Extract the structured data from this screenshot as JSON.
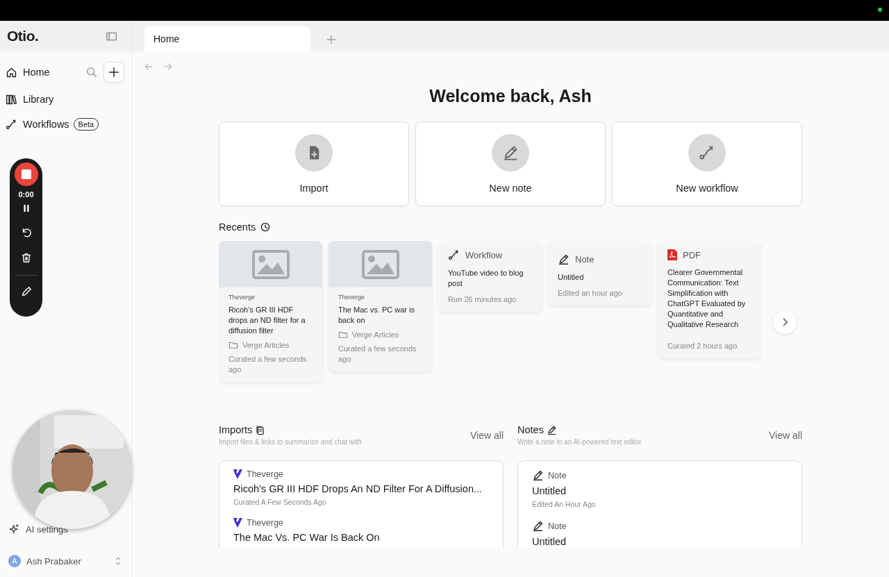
{
  "sidebar": {
    "logo": "Otio.",
    "nav": [
      {
        "kind": "home",
        "label": "Home"
      },
      {
        "kind": "library",
        "label": "Library"
      },
      {
        "kind": "workflows",
        "label": "Workflows",
        "badge": "Beta"
      }
    ],
    "bottom": [
      {
        "kind": "ai",
        "label": "AI settings"
      }
    ],
    "user": {
      "initial": "A",
      "name": "Ash Prabaker"
    }
  },
  "recorder": {
    "time": "0:00"
  },
  "tabs": [
    {
      "label": "Home",
      "selected": true
    }
  ],
  "heading": "Welcome back, Ash",
  "actions": [
    {
      "kind": "import",
      "label": "Import"
    },
    {
      "kind": "note",
      "label": "New note"
    },
    {
      "kind": "workflow",
      "label": "New workflow"
    }
  ],
  "recents": {
    "title": "Recents",
    "items": [
      {
        "kind": "article",
        "source": "Theverge",
        "title": "Ricoh’s GR III HDF drops an ND filter for a diffusion filter",
        "folder": "Verge Articles",
        "meta": "Curated a few seconds ago"
      },
      {
        "kind": "article",
        "source": "Theverge",
        "title": "The Mac vs. PC war is back on",
        "folder": "Verge Articles",
        "meta": "Curated a few seconds ago"
      },
      {
        "kind": "workflow",
        "type_label": "Workflow",
        "title": "YouTube video to blog post",
        "meta": "Run 26 minutes ago"
      },
      {
        "kind": "note",
        "type_label": "Note",
        "title": "Untitled",
        "meta": "Edited an hour ago"
      },
      {
        "kind": "pdf",
        "type_label": "PDF",
        "title": "Clearer Governmental Communication: Text Simplification with ChatGPT Evaluated by Quantitative and Qualitative Research",
        "meta": "Curated 2 hours ago"
      }
    ]
  },
  "sections": [
    {
      "kind": "imports",
      "title": "Imports",
      "subtitle": "Import files & links to summarize and chat with",
      "link": "View all",
      "items": [
        {
          "kind": "article",
          "source": "Theverge",
          "title": "Ricoh’s GR III HDF Drops An ND Filter For A Diffusion...",
          "meta": "Curated A Few Seconds Ago"
        },
        {
          "kind": "article",
          "source": "Theverge",
          "title": "The Mac Vs. PC War Is Back On"
        }
      ]
    },
    {
      "kind": "notes",
      "title": "Notes",
      "subtitle": "Write a note in an AI-powered text editor",
      "link": "View all",
      "items": [
        {
          "kind": "note",
          "source": "Note",
          "title": "Untitled",
          "meta": "Edited An Hour Ago"
        },
        {
          "kind": "note",
          "source": "Note",
          "title": "Untitled"
        }
      ]
    }
  ]
}
